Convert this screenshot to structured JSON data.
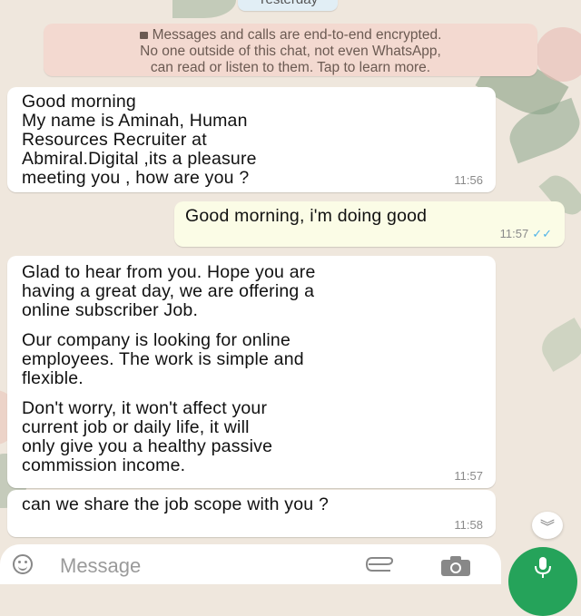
{
  "colors": {
    "wallpaper": "#efe7dd",
    "incoming_bubble": "#ffffff",
    "outgoing_bubble": "#fbfce6",
    "encryption_notice": "#f3d9d0",
    "read_ticks": "#4fb3e8",
    "mic_button": "#25a35a"
  },
  "date_chip": "Yesterday",
  "encryption_notice": {
    "icon": "lock-icon",
    "lines": [
      "Messages and calls are end-to-end encrypted.",
      "No one outside of this chat, not even WhatsApp,",
      "can read or listen to them. Tap to learn more."
    ]
  },
  "messages": [
    {
      "direction": "incoming",
      "text": "Good morning\nMy name is Aminah, Human\nResources Recruiter at\nAbmiral.Digital ,its a pleasure\nmeeting you , how are you ?",
      "time": "11:56"
    },
    {
      "direction": "outgoing",
      "text": "Good morning, i'm doing good",
      "time": "11:57",
      "status_icon": "double-check-icon"
    },
    {
      "direction": "incoming",
      "paragraphs": [
        "Glad to hear from you. Hope you are\nhaving a great day, we are offering a\nonline subscriber Job.",
        "Our company is looking for online\nemployees. The work is simple and\nflexible.",
        "Don't worry, it won't affect your\ncurrent job or daily life, it will\nonly give you a healthy passive\ncommission income."
      ],
      "time": "11:57"
    },
    {
      "direction": "incoming",
      "text": "can we share the job scope with you ?",
      "time": "11:58"
    }
  ],
  "scroll_button_icon": "double-chevron-down-icon",
  "input_bar": {
    "placeholder": "Message",
    "emoji_icon": "emoji-icon",
    "attach_icon": "paperclip-icon",
    "camera_icon": "camera-icon",
    "mic_icon": "microphone-icon"
  }
}
